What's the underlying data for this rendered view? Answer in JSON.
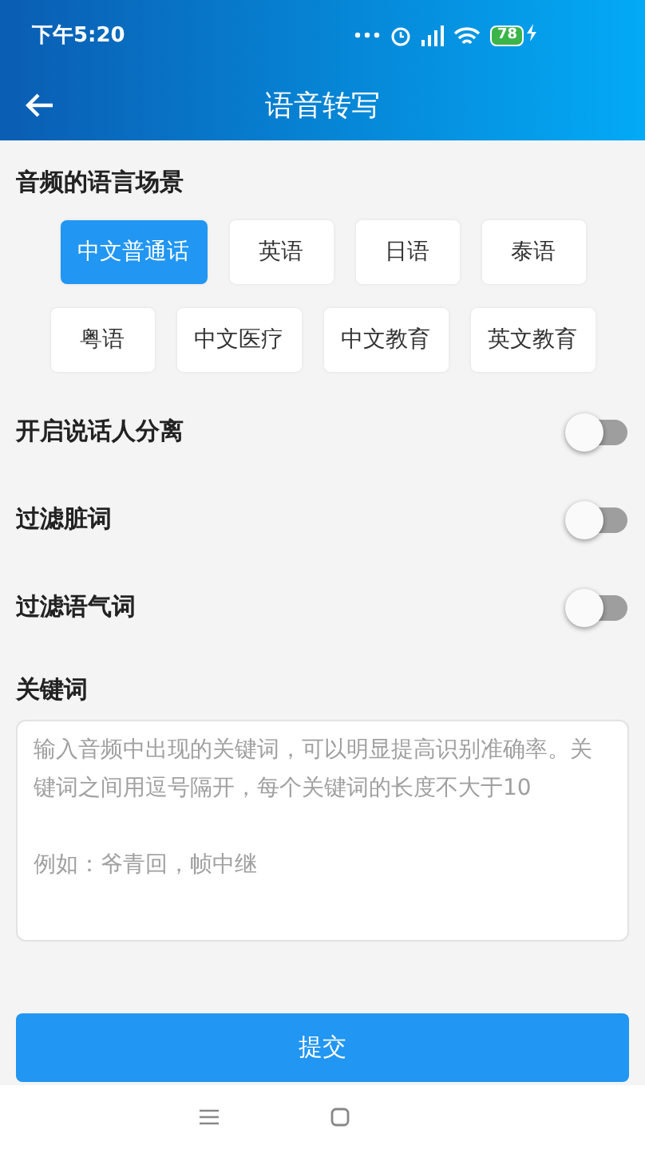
{
  "status_bar": {
    "time": "下午5:20",
    "battery": "78"
  },
  "app_bar": {
    "title": "语音转写"
  },
  "language_section": {
    "title": "音频的语言场景",
    "options": [
      {
        "label": "中文普通话",
        "selected": true
      },
      {
        "label": "英语",
        "selected": false
      },
      {
        "label": "日语",
        "selected": false
      },
      {
        "label": "泰语",
        "selected": false
      },
      {
        "label": "粤语",
        "selected": false
      },
      {
        "label": "中文医疗",
        "selected": false
      },
      {
        "label": "中文教育",
        "selected": false
      },
      {
        "label": "英文教育",
        "selected": false
      }
    ]
  },
  "switches": [
    {
      "label": "开启说话人分离",
      "on": false
    },
    {
      "label": "过滤脏词",
      "on": false
    },
    {
      "label": "过滤语气词",
      "on": false
    }
  ],
  "keywords": {
    "title": "关键词",
    "placeholder": "输入音频中出现的关键词，可以明显提高识别准确率。关键词之间用逗号隔开，每个关键词的长度不大于10\n\n例如：爷青回，帧中继"
  },
  "submit_button": {
    "label": "提交"
  }
}
